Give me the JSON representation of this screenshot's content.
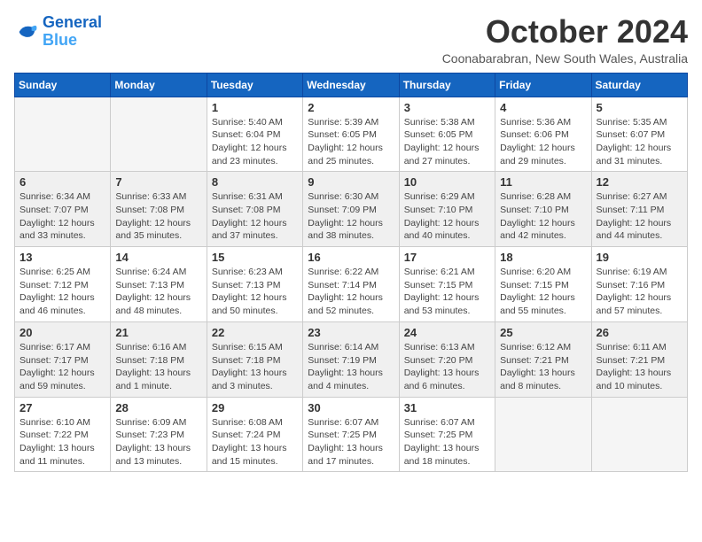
{
  "logo": {
    "line1": "General",
    "line2": "Blue"
  },
  "title": "October 2024",
  "location": "Coonabarabran, New South Wales, Australia",
  "weekdays": [
    "Sunday",
    "Monday",
    "Tuesday",
    "Wednesday",
    "Thursday",
    "Friday",
    "Saturday"
  ],
  "weeks": [
    {
      "shaded": false,
      "days": [
        {
          "number": "",
          "info": ""
        },
        {
          "number": "",
          "info": ""
        },
        {
          "number": "1",
          "info": "Sunrise: 5:40 AM\nSunset: 6:04 PM\nDaylight: 12 hours\nand 23 minutes."
        },
        {
          "number": "2",
          "info": "Sunrise: 5:39 AM\nSunset: 6:05 PM\nDaylight: 12 hours\nand 25 minutes."
        },
        {
          "number": "3",
          "info": "Sunrise: 5:38 AM\nSunset: 6:05 PM\nDaylight: 12 hours\nand 27 minutes."
        },
        {
          "number": "4",
          "info": "Sunrise: 5:36 AM\nSunset: 6:06 PM\nDaylight: 12 hours\nand 29 minutes."
        },
        {
          "number": "5",
          "info": "Sunrise: 5:35 AM\nSunset: 6:07 PM\nDaylight: 12 hours\nand 31 minutes."
        }
      ]
    },
    {
      "shaded": true,
      "days": [
        {
          "number": "6",
          "info": "Sunrise: 6:34 AM\nSunset: 7:07 PM\nDaylight: 12 hours\nand 33 minutes."
        },
        {
          "number": "7",
          "info": "Sunrise: 6:33 AM\nSunset: 7:08 PM\nDaylight: 12 hours\nand 35 minutes."
        },
        {
          "number": "8",
          "info": "Sunrise: 6:31 AM\nSunset: 7:08 PM\nDaylight: 12 hours\nand 37 minutes."
        },
        {
          "number": "9",
          "info": "Sunrise: 6:30 AM\nSunset: 7:09 PM\nDaylight: 12 hours\nand 38 minutes."
        },
        {
          "number": "10",
          "info": "Sunrise: 6:29 AM\nSunset: 7:10 PM\nDaylight: 12 hours\nand 40 minutes."
        },
        {
          "number": "11",
          "info": "Sunrise: 6:28 AM\nSunset: 7:10 PM\nDaylight: 12 hours\nand 42 minutes."
        },
        {
          "number": "12",
          "info": "Sunrise: 6:27 AM\nSunset: 7:11 PM\nDaylight: 12 hours\nand 44 minutes."
        }
      ]
    },
    {
      "shaded": false,
      "days": [
        {
          "number": "13",
          "info": "Sunrise: 6:25 AM\nSunset: 7:12 PM\nDaylight: 12 hours\nand 46 minutes."
        },
        {
          "number": "14",
          "info": "Sunrise: 6:24 AM\nSunset: 7:13 PM\nDaylight: 12 hours\nand 48 minutes."
        },
        {
          "number": "15",
          "info": "Sunrise: 6:23 AM\nSunset: 7:13 PM\nDaylight: 12 hours\nand 50 minutes."
        },
        {
          "number": "16",
          "info": "Sunrise: 6:22 AM\nSunset: 7:14 PM\nDaylight: 12 hours\nand 52 minutes."
        },
        {
          "number": "17",
          "info": "Sunrise: 6:21 AM\nSunset: 7:15 PM\nDaylight: 12 hours\nand 53 minutes."
        },
        {
          "number": "18",
          "info": "Sunrise: 6:20 AM\nSunset: 7:15 PM\nDaylight: 12 hours\nand 55 minutes."
        },
        {
          "number": "19",
          "info": "Sunrise: 6:19 AM\nSunset: 7:16 PM\nDaylight: 12 hours\nand 57 minutes."
        }
      ]
    },
    {
      "shaded": true,
      "days": [
        {
          "number": "20",
          "info": "Sunrise: 6:17 AM\nSunset: 7:17 PM\nDaylight: 12 hours\nand 59 minutes."
        },
        {
          "number": "21",
          "info": "Sunrise: 6:16 AM\nSunset: 7:18 PM\nDaylight: 13 hours\nand 1 minute."
        },
        {
          "number": "22",
          "info": "Sunrise: 6:15 AM\nSunset: 7:18 PM\nDaylight: 13 hours\nand 3 minutes."
        },
        {
          "number": "23",
          "info": "Sunrise: 6:14 AM\nSunset: 7:19 PM\nDaylight: 13 hours\nand 4 minutes."
        },
        {
          "number": "24",
          "info": "Sunrise: 6:13 AM\nSunset: 7:20 PM\nDaylight: 13 hours\nand 6 minutes."
        },
        {
          "number": "25",
          "info": "Sunrise: 6:12 AM\nSunset: 7:21 PM\nDaylight: 13 hours\nand 8 minutes."
        },
        {
          "number": "26",
          "info": "Sunrise: 6:11 AM\nSunset: 7:21 PM\nDaylight: 13 hours\nand 10 minutes."
        }
      ]
    },
    {
      "shaded": false,
      "days": [
        {
          "number": "27",
          "info": "Sunrise: 6:10 AM\nSunset: 7:22 PM\nDaylight: 13 hours\nand 11 minutes."
        },
        {
          "number": "28",
          "info": "Sunrise: 6:09 AM\nSunset: 7:23 PM\nDaylight: 13 hours\nand 13 minutes."
        },
        {
          "number": "29",
          "info": "Sunrise: 6:08 AM\nSunset: 7:24 PM\nDaylight: 13 hours\nand 15 minutes."
        },
        {
          "number": "30",
          "info": "Sunrise: 6:07 AM\nSunset: 7:25 PM\nDaylight: 13 hours\nand 17 minutes."
        },
        {
          "number": "31",
          "info": "Sunrise: 6:07 AM\nSunset: 7:25 PM\nDaylight: 13 hours\nand 18 minutes."
        },
        {
          "number": "",
          "info": ""
        },
        {
          "number": "",
          "info": ""
        }
      ]
    }
  ]
}
